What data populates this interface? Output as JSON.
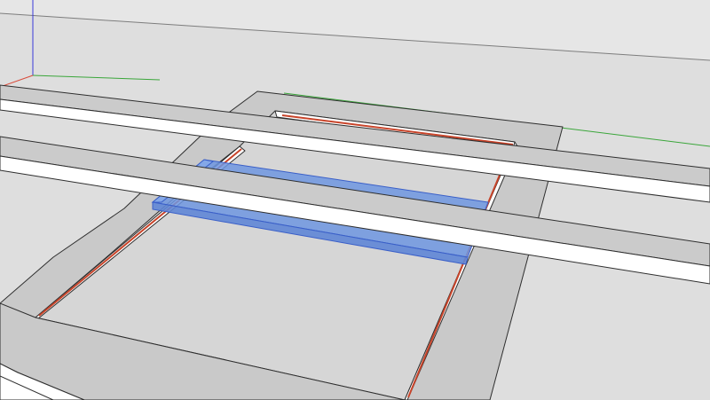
{
  "app": {
    "view": "3d-modeling-viewport",
    "colors": {
      "background_sky": "#e3e3e3",
      "background_ground": "#d6d6d6",
      "frame_top": "#c9c9c9",
      "frame_side": "#ffffff",
      "rail_top": "#cbcbcb",
      "rail_side": "#ffffff",
      "seam_red": "#c8442a",
      "selection_fill": "#6f96e0",
      "selection_edge": "#3a5fc8",
      "axis_red": "#d94a3a",
      "axis_green": "#3aa63a",
      "axis_blue": "#3a3ad9",
      "horizon": "#7d7d7d",
      "edge": "#2e2e2e"
    },
    "icons": [
      "axis-origin-icon"
    ]
  }
}
